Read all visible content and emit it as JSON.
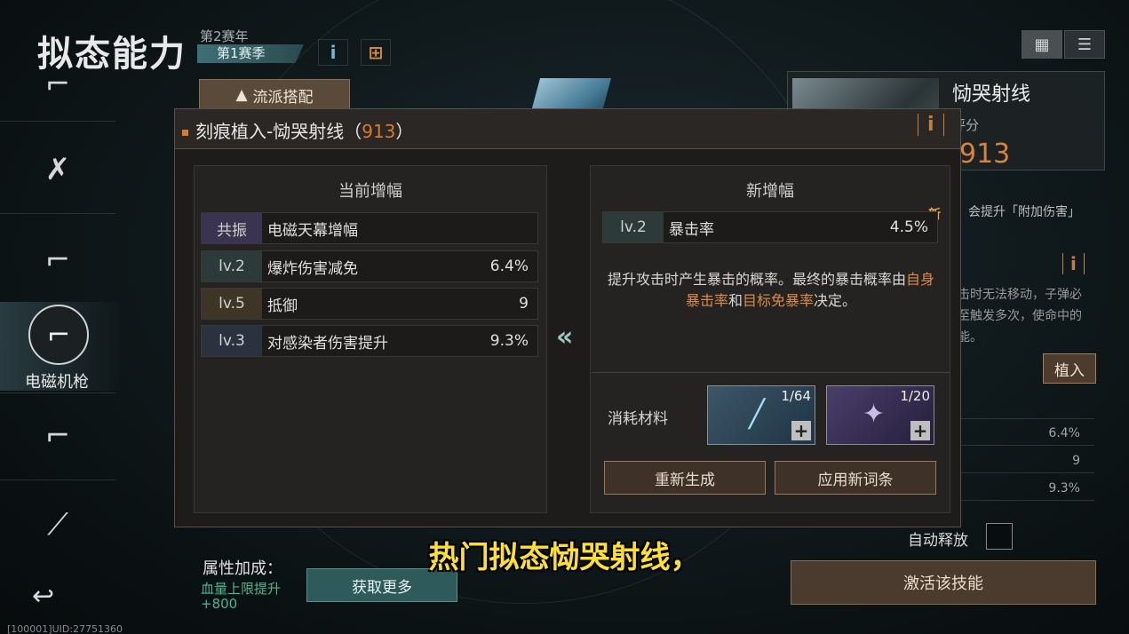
{
  "header": {
    "title": "拟态能力",
    "season_year": "第2赛年",
    "season": "第1赛季",
    "info_label": "i",
    "cart_label": "🛒"
  },
  "sidebar": {
    "selected_label": "电磁机枪",
    "items": [
      {
        "icon": "rifle-icon"
      },
      {
        "icon": "crossed-guns-icon"
      },
      {
        "icon": "grenade-launcher-icon"
      },
      {
        "icon": "electromagnetic-gun-icon"
      },
      {
        "icon": "shotgun-icon"
      },
      {
        "icon": "blade-icon"
      }
    ],
    "back_icon": "↩"
  },
  "uid": "[100001]UID:27751360",
  "school_button": "流派搭配",
  "right_panel": {
    "name": "恸哭射线",
    "score_label": "评分",
    "score": "913",
    "desc_line1": "会提升「附加伤害」",
    "desc2_line1": "击时无法移动，子弹必",
    "desc2_line2": "至触发多次，使命中的",
    "desc2_line3": "能。",
    "implant_button": "植入",
    "values": [
      "6.4%",
      "9",
      "9.3%"
    ],
    "auto_release_label": "自动释放",
    "activate_button": "激活该技能"
  },
  "attributes": {
    "label": "属性加成：",
    "value_line1": "血量上限提升",
    "value_line2": "+800",
    "get_more_button": "获取更多"
  },
  "subtitle": "热门拟态恸哭射线，",
  "modal": {
    "title": "刻痕植入-恸哭射线（",
    "score": "913",
    "title_end": "）",
    "info_label": "i",
    "current": {
      "title": "当前增幅",
      "rows": [
        {
          "level": "共振",
          "name": "电磁天幕增幅",
          "value": ""
        },
        {
          "level": "lv.2",
          "name": "爆炸伤害减免",
          "value": "6.4%"
        },
        {
          "level": "lv.5",
          "name": "抵御",
          "value": "9"
        },
        {
          "level": "lv.3",
          "name": "对感染者伤害提升",
          "value": "9.3%"
        }
      ]
    },
    "arrow": "«",
    "new": {
      "title": "新增幅",
      "badge": "新",
      "row": {
        "level": "lv.2",
        "name": "暴击率",
        "value": "4.5%"
      },
      "desc_part1": "提升攻击时产生暴击的概率。最终的暴击概率由",
      "desc_hl1": "自身暴击率",
      "desc_part2": "和",
      "desc_hl2": "目标免暴率",
      "desc_part3": "决定。"
    },
    "materials": {
      "label": "消耗材料",
      "items": [
        {
          "count": "1/64",
          "icon": "syringe-icon"
        },
        {
          "count": "1/20",
          "icon": "chip-icon"
        }
      ]
    },
    "regen_button": "重新生成",
    "apply_button": "应用新词条"
  },
  "colors": {
    "accent_orange": "#d97a30",
    "level_lv2": "#2c3a3a",
    "level_lv5": "#3e3526",
    "level_lv3": "#2a3240",
    "level_resonance": "#3a3450"
  }
}
